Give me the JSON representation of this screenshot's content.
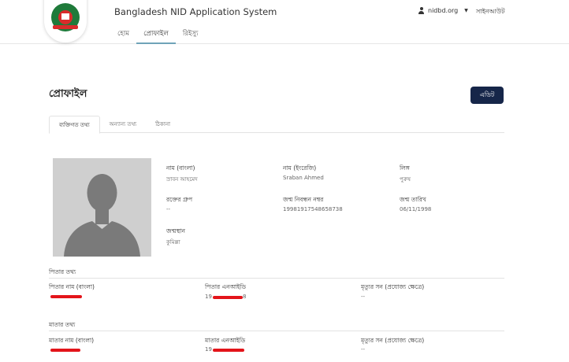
{
  "header": {
    "app_title": "Bangladesh NID Application System",
    "nav": [
      "হোম",
      "প্রোফাইল",
      "রিইস্যু"
    ],
    "username": "nidbd.org",
    "logout": "সাইনআউট"
  },
  "page": {
    "title": "প্রোফাইল",
    "edit_label": "এডিট"
  },
  "tabs": [
    "ব্যক্তিগত তথ্য",
    "অন্যান্য তথ্য",
    "ঠিকানা"
  ],
  "personal": {
    "name_bn_label": "নাম (বাংলা)",
    "name_bn_value": "স্রাবন আহমেদ",
    "name_en_label": "নাম (ইংরেজি)",
    "name_en_value": "Sraban Ahmed",
    "gender_label": "লিঙ্গ",
    "gender_value": "পুরুষ",
    "blood_label": "রক্তের গ্রুপ",
    "blood_value": "--",
    "birth_reg_label": "জন্ম নিবন্ধন নম্বর",
    "birth_reg_value": "19981917548658738",
    "dob_label": "জন্ম তারিখ",
    "dob_value": "06/11/1998",
    "birthplace_label": "জন্মস্থান",
    "birthplace_value": "কুমিল্লা"
  },
  "father": {
    "section_title": "পিতার তথ্য",
    "name_label": "পিতার নাম (বাংলা)",
    "nid_label": "পিতার এনআইডি",
    "nid_value_prefix": "19",
    "nid_value_suffix": "8",
    "death_label": "মৃত্যুর সন (প্রযোজ্য ক্ষেত্রে)",
    "death_value": "--"
  },
  "mother": {
    "section_title": "মাতার তথ্য",
    "name_label": "মাতার নাম (বাংলা)",
    "nid_label": "মাতার এনআইডি",
    "nid_value_prefix": "19",
    "death_label": "মৃত্যুর সন (প্রযোজ্য ক্ষেত্রে)",
    "death_value": "--"
  },
  "colors": {
    "primary_button": "#162649",
    "redaction": "#e3141a"
  }
}
